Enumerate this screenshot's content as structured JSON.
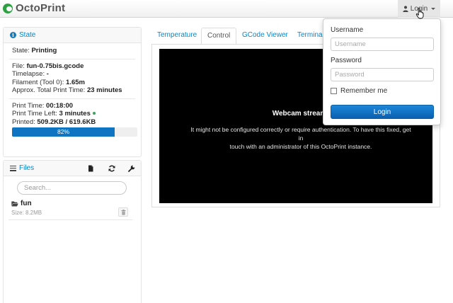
{
  "navbar": {
    "brand": "OctoPrint",
    "login_label": "Login"
  },
  "state_panel": {
    "title": "State",
    "state_label": "State:",
    "state_value": "Printing",
    "file_label": "File:",
    "file_value": "fun-0.75bis.gcode",
    "timelapse_label": "Timelapse:",
    "timelapse_value": "-",
    "filament_label": "Filament (Tool 0):",
    "filament_value": "1.65m",
    "approx_label": "Approx. Total Print Time:",
    "approx_value": "23 minutes",
    "print_time_label": "Print Time:",
    "print_time_value": "00:18:00",
    "time_left_label": "Print Time Left:",
    "time_left_value": "3 minutes",
    "printed_label": "Printed:",
    "printed_value": "509.2KB / 619.6KB",
    "progress_percent": 82,
    "progress_label": "82%"
  },
  "files_panel": {
    "title": "Files",
    "search_placeholder": "Search...",
    "entries": [
      {
        "name": "fun",
        "size": "Size: 8.2MB"
      }
    ]
  },
  "tabs": [
    {
      "label": "Temperature",
      "active": false
    },
    {
      "label": "Control",
      "active": true
    },
    {
      "label": "GCode Viewer",
      "active": false
    },
    {
      "label": "Terminal",
      "active": false
    }
  ],
  "webcam": {
    "title": "Webcam stream not lo",
    "message_line1": "It might not be configured correctly or require authentication. To have this fixed, get in",
    "message_line2": "touch with an administrator of this OctoPrint instance."
  },
  "login_dropdown": {
    "username_label": "Username",
    "username_placeholder": "Username",
    "password_label": "Password",
    "password_placeholder": "Password",
    "remember_label": "Remember me",
    "login_button": "Login"
  },
  "colors": {
    "accent": "#0088cc",
    "progress": "#0f74c2",
    "brand_green": "#2ea043"
  }
}
